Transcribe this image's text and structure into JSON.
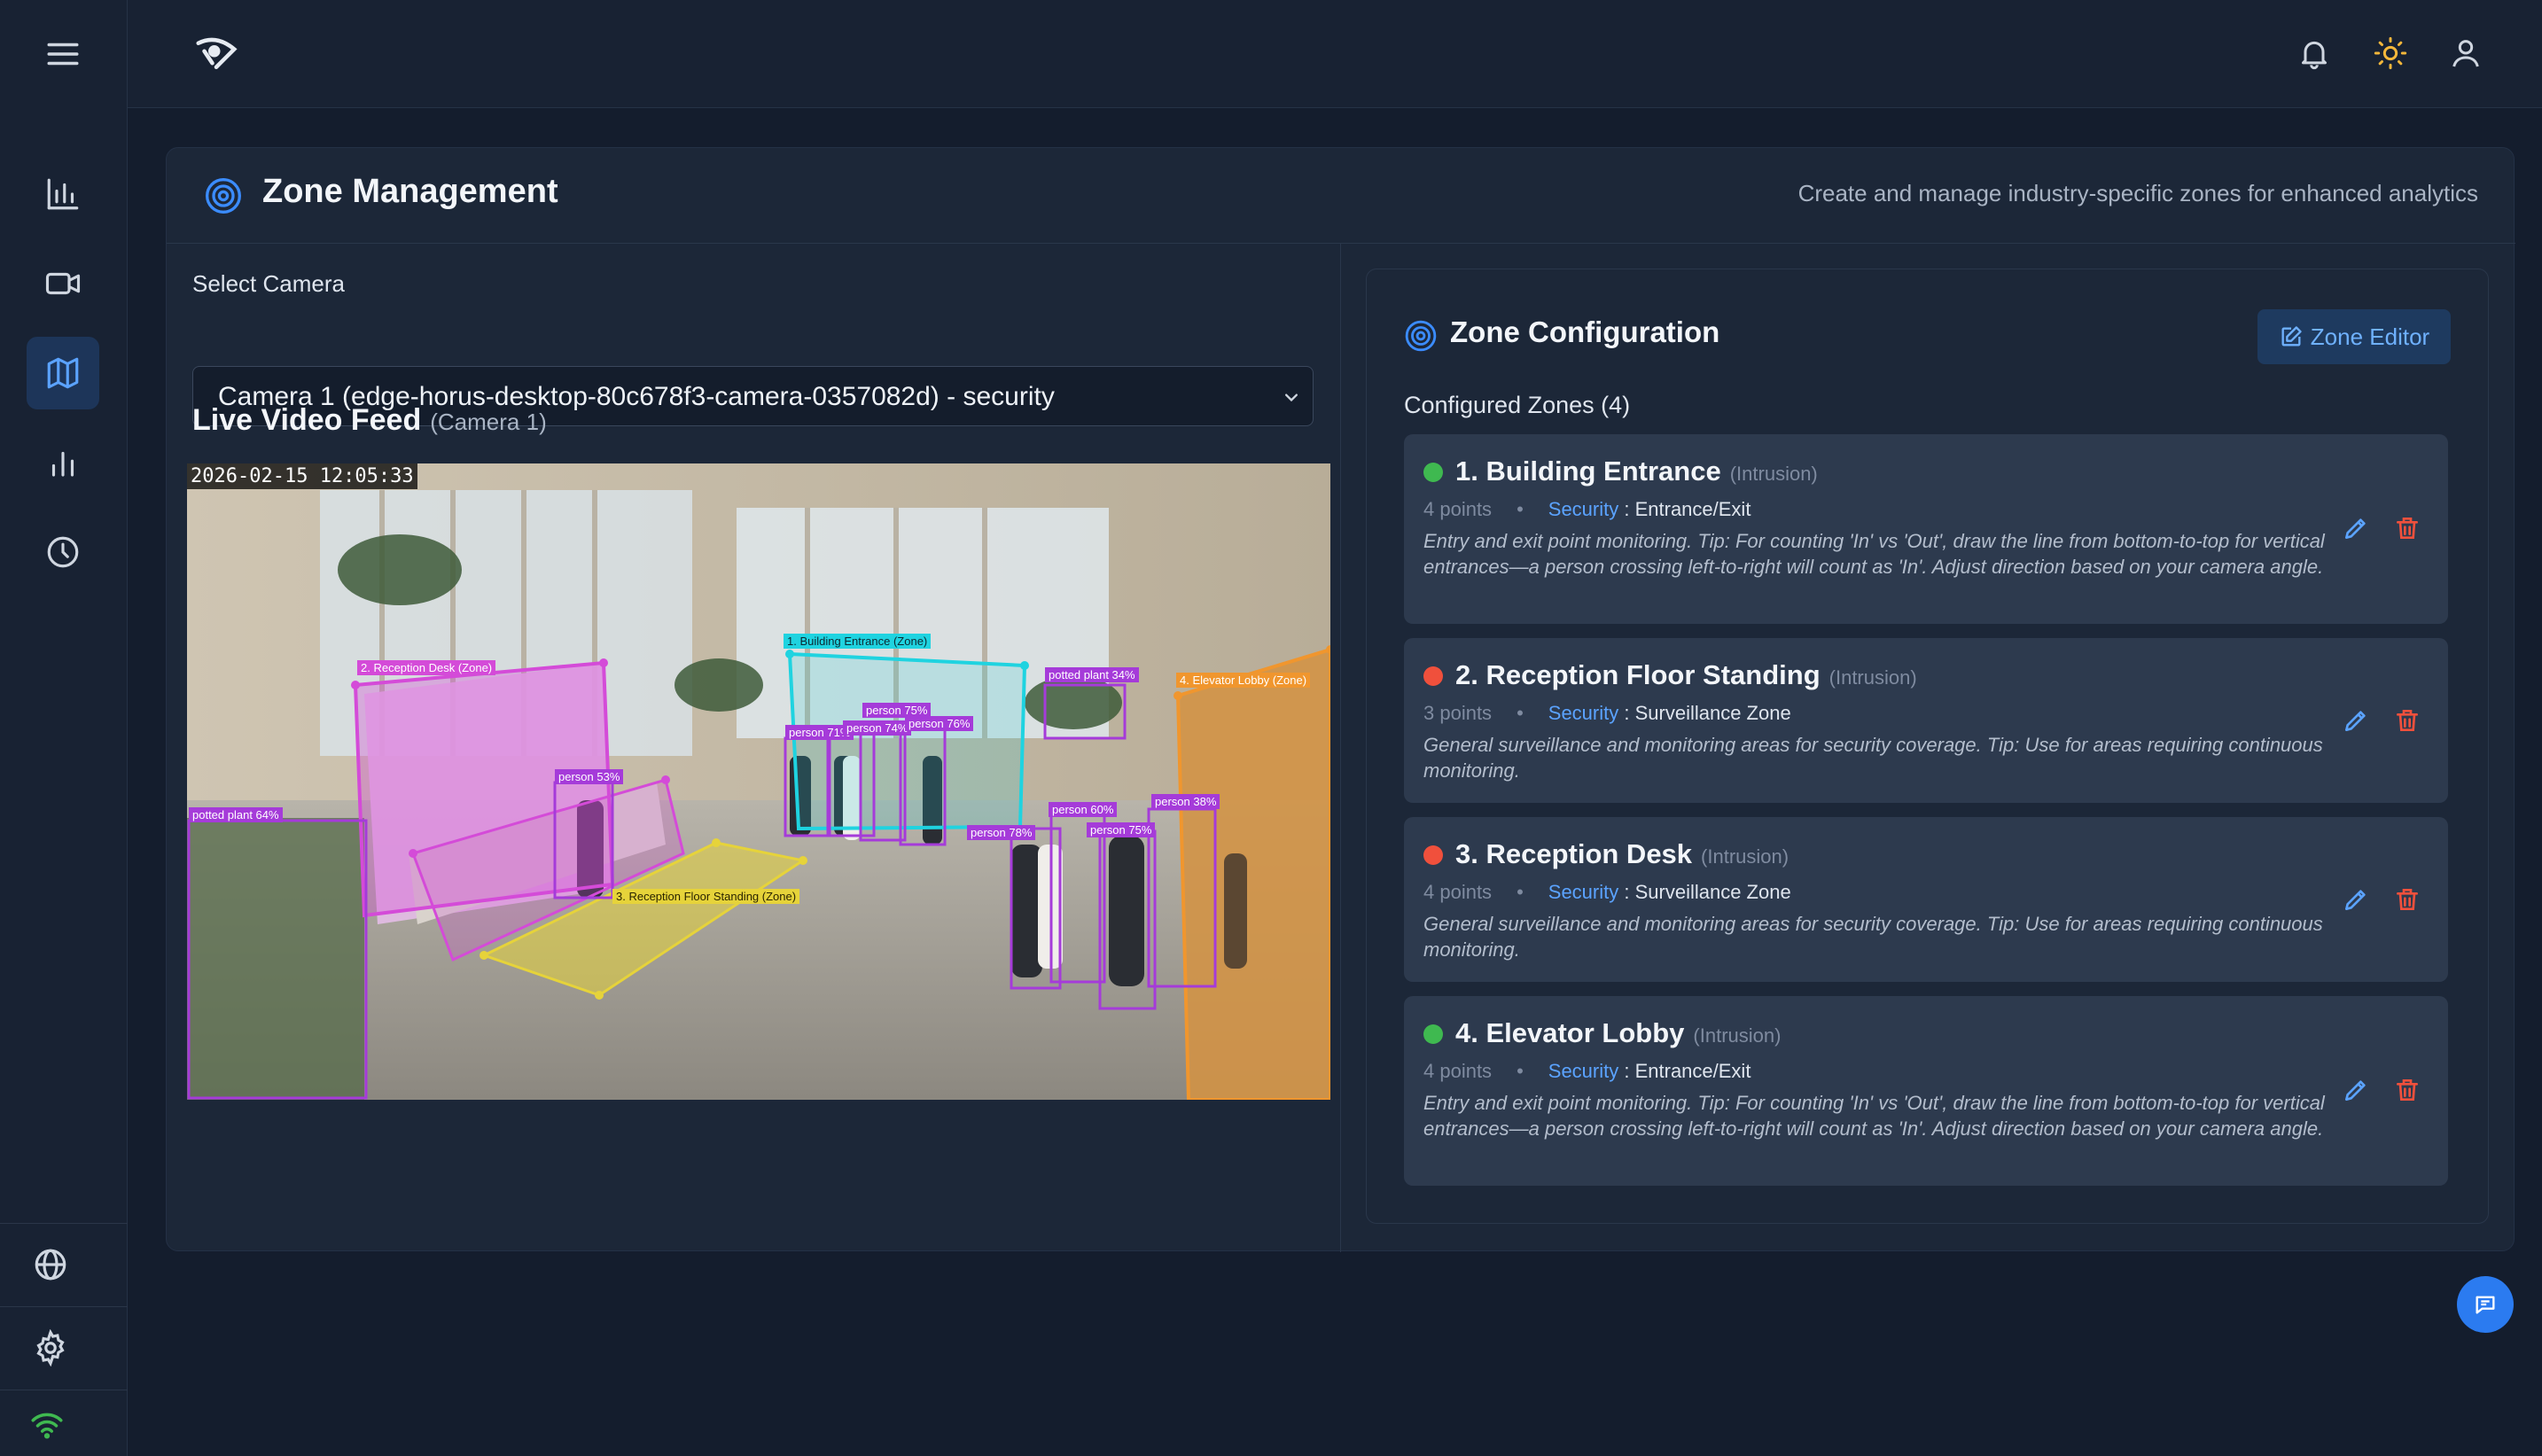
{
  "app": {
    "page_title": "Zone Management",
    "page_subtitle": "Create and manage industry-specific zones for enhanced analytics"
  },
  "camera_select": {
    "label": "Select Camera",
    "selected": "Camera 1 (edge-horus-desktop-80c678f3-camera-0357082d) - security"
  },
  "video": {
    "title": "Live Video Feed",
    "camera_tag": "(Camera 1)",
    "timestamp": "2026-02-15 12:05:33",
    "zone_labels": [
      "1. Building Entrance (Zone)",
      "2. Reception Desk (Zone)",
      "3. Reception Floor Standing (Zone)",
      "4. Elevator Lobby (Zone)"
    ],
    "detections": [
      "potted plant 64%",
      "person 53%",
      "person 71%",
      "person 74%",
      "person 75%",
      "person 76%",
      "potted plant 34%",
      "person 60%",
      "person 75%",
      "person 78%",
      "person 38%"
    ]
  },
  "zone_config": {
    "title": "Zone Configuration",
    "editor_button": "Zone Editor",
    "count_label": "Configured Zones (4)",
    "separator": "•",
    "zones": [
      {
        "name": "1. Building Entrance",
        "type": "(Intrusion)",
        "points": "4 points",
        "industry": "Security",
        "category": "Entrance/Exit",
        "status_color": "#3fb950",
        "description": "Entry and exit point monitoring. Tip: For counting 'In' vs 'Out', draw the line from bottom-to-top for vertical entrances—a person crossing left-to-right will count as 'In'. Adjust direction based on your camera angle."
      },
      {
        "name": "2. Reception Floor Standing",
        "type": "(Intrusion)",
        "points": "3 points",
        "industry": "Security",
        "category": "Surveillance Zone",
        "status_color": "#f0503c",
        "description": "General surveillance and monitoring areas for security coverage. Tip: Use for areas requiring continuous monitoring."
      },
      {
        "name": "3. Reception Desk",
        "type": "(Intrusion)",
        "points": "4 points",
        "industry": "Security",
        "category": "Surveillance Zone",
        "status_color": "#f0503c",
        "description": "General surveillance and monitoring areas for security coverage. Tip: Use for areas requiring continuous monitoring."
      },
      {
        "name": "4. Elevator Lobby",
        "type": "(Intrusion)",
        "points": "4 points",
        "industry": "Security",
        "category": "Entrance/Exit",
        "status_color": "#3fb950",
        "description": "Entry and exit point monitoring. Tip: For counting 'In' vs 'Out', draw the line from bottom-to-top for vertical entrances—a person crossing left-to-right will count as 'In'. Adjust direction based on your camera angle."
      }
    ]
  },
  "icons": {
    "menu": "menu-icon",
    "logo": "eye-logo-icon",
    "nav": [
      "bar-chart-icon",
      "video-camera-icon",
      "map-icon",
      "stats-icon",
      "clock-icon"
    ],
    "bottom": [
      "globe-icon",
      "gear-icon",
      "wifi-icon"
    ],
    "top_right": [
      "bell-icon",
      "sun-icon",
      "user-icon"
    ]
  },
  "colors": {
    "accent": "#3b8cff",
    "zone_entrance": "#1fd3e0",
    "zone_desk": "#d44bd8",
    "zone_floor": "#e6d33a",
    "zone_elevator": "#f0962e"
  }
}
